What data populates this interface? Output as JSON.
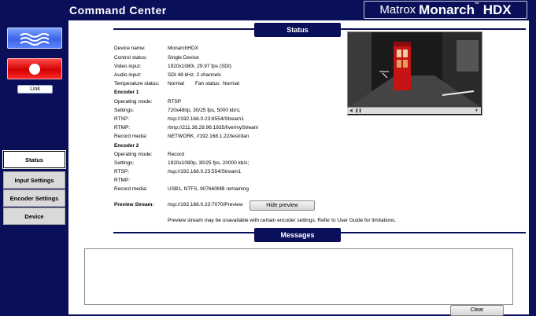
{
  "header": {
    "app_title": "Command Center",
    "brand_prefix": "Matrox",
    "brand_name": "Monarch",
    "brand_tm": "™",
    "brand_suffix": "HDX"
  },
  "sidebar": {
    "stream_icon": "waves-icon",
    "record_icon": "record-dot-icon",
    "link_label": "Link",
    "items": [
      {
        "label": "Status",
        "active": true
      },
      {
        "label": "Input Settings",
        "active": false
      },
      {
        "label": "Encoder Settings",
        "active": false
      },
      {
        "label": "Device",
        "active": false
      }
    ]
  },
  "status": {
    "section_title": "Status",
    "fields": [
      {
        "label": "Device name:",
        "value": "MonarchHDX"
      },
      {
        "label": "Control status:",
        "value": "Single Device"
      },
      {
        "label": "Video input:",
        "value": "1920x1080i, 29.97 fps (SDI)"
      },
      {
        "label": "Audio input:",
        "value": "SDI 48 kHz, 2 channels"
      }
    ],
    "temperature_label": "Temperature status:",
    "temperature_value": "Normal",
    "fan_label": "Fan status:",
    "fan_value": "Normal",
    "encoder1": {
      "title": "Encoder 1",
      "fields": [
        {
          "label": "Operating mode:",
          "value": "RTSP"
        },
        {
          "label": "Settings:",
          "value": "720x480p, 30/25 fps, 5000 kb/s;"
        },
        {
          "label": "RTSP:",
          "value": "rtsp://192.168.0.23:8554/Stream1"
        },
        {
          "label": "RTMP:",
          "value": "rtmp://211.36.28.96:1935/live/myStream"
        },
        {
          "label": "Record media:",
          "value": "NETWORK, //192.168.1.22/test/dan"
        }
      ]
    },
    "encoder2": {
      "title": "Encoder 2",
      "fields": [
        {
          "label": "Operating mode:",
          "value": "Record"
        },
        {
          "label": "Settings:",
          "value": "1920x1080p, 30/25 fps, 20000 kb/s;"
        },
        {
          "label": "RTSP:",
          "value": "rtsp://192.168.0.23:554/Stream1"
        },
        {
          "label": "RTMP:",
          "value": ""
        },
        {
          "label": "Record media:",
          "value": "USB1, NTFS, 907660MB remaining"
        }
      ]
    },
    "preview_label": "Preview Stream:",
    "preview_url": "rtsp://192.168.0.23:7070/Preview",
    "hide_preview_label": "Hide preview",
    "preview_note": "Preview stream may be unavailable with certain encoder settings. Refer to User Guide for limitations."
  },
  "video": {
    "play_icon": "play-icon",
    "pause_icon": "pause-icon",
    "menu_icon": "chevron-down-icon"
  },
  "messages": {
    "section_title": "Messages",
    "clear_label": "Clear"
  }
}
